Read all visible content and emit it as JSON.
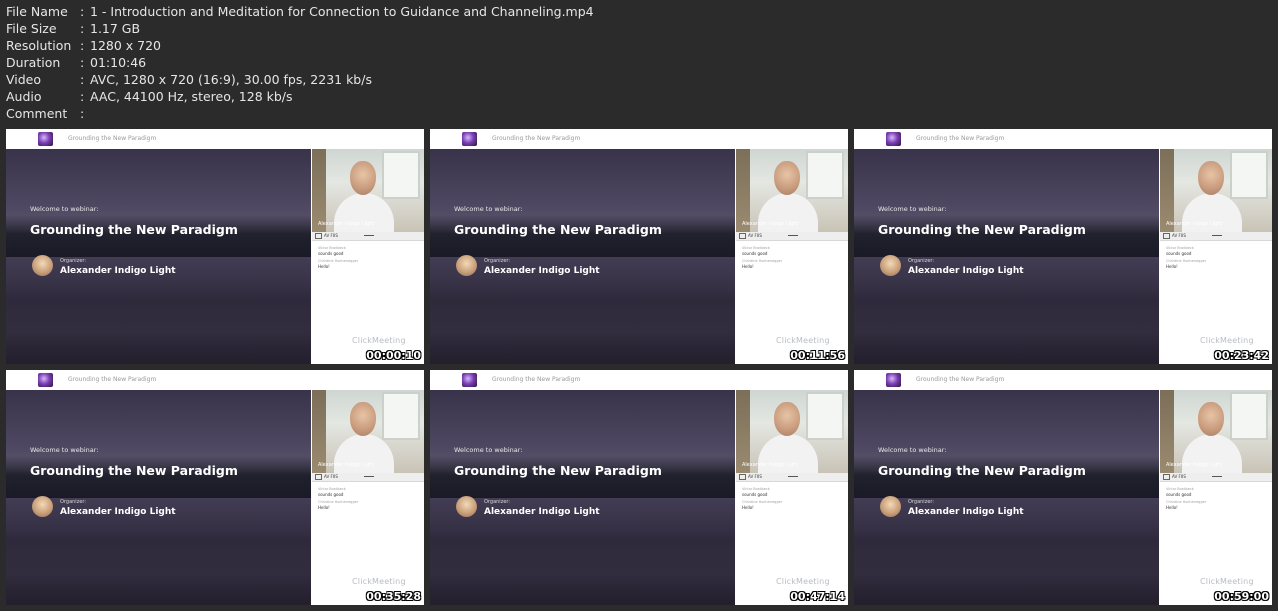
{
  "info": [
    {
      "key": "File Name",
      "sep": ":",
      "value": "1 - Introduction and Meditation for Connection to Guidance and Channeling.mp4"
    },
    {
      "key": "File Size",
      "sep": ":",
      "value": "1.17 GB"
    },
    {
      "key": "Resolution",
      "sep": ":",
      "value": "1280 x 720"
    },
    {
      "key": "Duration",
      "sep": ":",
      "value": "01:10:46"
    },
    {
      "key": "Video",
      "sep": ":",
      "value": "AVC, 1280 x 720 (16:9), 30.00 fps, 2231 kb/s"
    },
    {
      "key": "Audio",
      "sep": ":",
      "value": "AAC, 44100 Hz, stereo, 128 kb/s"
    },
    {
      "key": "Comment",
      "sep": ":",
      "value": ""
    }
  ],
  "frame": {
    "bar_title": "Grounding the New Paradigm",
    "welcome": "Welcome to webinar:",
    "title": "Grounding the New Paradigm",
    "organizer_label": "Organizer:",
    "organizer_name": "Alexander Indigo Light",
    "presenter_label": "Alexander Indigo Light",
    "sidebar_tab": "AV F0S",
    "chat_1_meta": "Victor Bradbeck",
    "chat_1": "sounds good",
    "chat_2_meta": "Christine Hochenegger",
    "chat_2": "Hello!",
    "brand": "ClickMeeting"
  },
  "thumbnails": [
    {
      "timestamp": "00:00:10"
    },
    {
      "timestamp": "00:11:56"
    },
    {
      "timestamp": "00:23:42"
    },
    {
      "timestamp": "00:35:28"
    },
    {
      "timestamp": "00:47:14"
    },
    {
      "timestamp": "00:59:00"
    }
  ]
}
